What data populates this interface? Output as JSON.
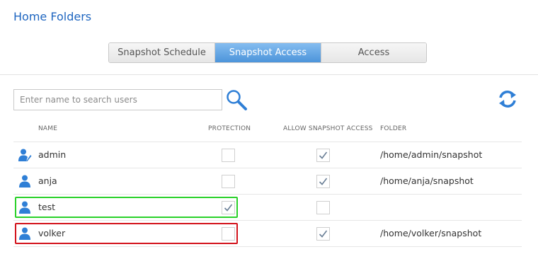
{
  "page": {
    "title": "Home Folders"
  },
  "tabs": [
    {
      "label": "Snapshot Schedule",
      "active": false
    },
    {
      "label": "Snapshot Access",
      "active": true
    },
    {
      "label": "Access",
      "active": false
    }
  ],
  "search": {
    "placeholder": "Enter name to search users",
    "value": ""
  },
  "icons": {
    "search": "search-icon",
    "refresh": "refresh-icon",
    "user": "user-icon",
    "admin": "admin-user-icon"
  },
  "colors": {
    "accent": "#1f66c0",
    "active_tab": "#5ea3e6",
    "highlight_green": "#2ad12a",
    "highlight_red": "#d3131c"
  },
  "table": {
    "headers": {
      "name": "NAME",
      "protection": "PROTECTION",
      "allow": "ALLOW SNAPSHOT ACCESS",
      "folder": "FOLDER"
    },
    "rows": [
      {
        "name": "admin",
        "admin": true,
        "protection": false,
        "allow": true,
        "folder": "/home/admin/snapshot"
      },
      {
        "name": "anja",
        "admin": false,
        "protection": false,
        "allow": true,
        "folder": "/home/anja/snapshot"
      },
      {
        "name": "test",
        "admin": false,
        "protection": true,
        "allow": false,
        "folder": ""
      },
      {
        "name": "volker",
        "admin": false,
        "protection": false,
        "allow": true,
        "folder": "/home/volker/snapshot"
      }
    ]
  }
}
